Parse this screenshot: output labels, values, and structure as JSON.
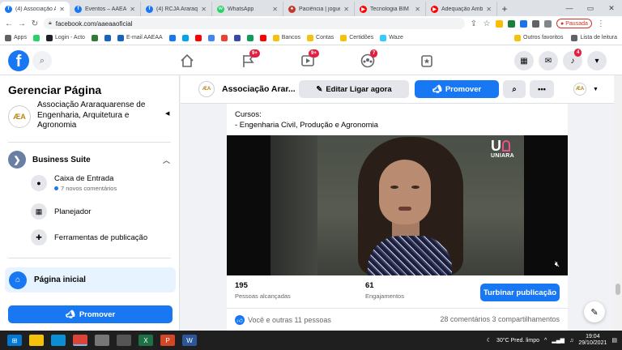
{
  "browser": {
    "tabs": [
      {
        "title": "(4) Associação Ar",
        "color": "#1877f2",
        "glyph": "f",
        "active": true
      },
      {
        "title": "Eventos – AAEAA",
        "color": "#1877f2",
        "glyph": "f"
      },
      {
        "title": "(4) RCJA Araraqu",
        "color": "#1877f2",
        "glyph": "f"
      },
      {
        "title": "WhatsApp",
        "color": "#25d366",
        "glyph": "w"
      },
      {
        "title": "Paciência | jogue",
        "color": "#c0392b",
        "glyph": "♠"
      },
      {
        "title": "Tecnologia BIM",
        "color": "#ff0000",
        "glyph": "▶"
      },
      {
        "title": "Adequação Amb",
        "color": "#ff0000",
        "glyph": "▶"
      }
    ],
    "new_tab": "+",
    "url": "facebook.com/aaeaaoficial",
    "paused_label": "Pausada",
    "bookmarks": [
      {
        "label": "Apps",
        "color": "#5f6368"
      },
      {
        "label": "",
        "color": "#25d366"
      },
      {
        "label": "Login - Acto",
        "color": "#202124"
      },
      {
        "label": "",
        "color": "#2e7d32"
      },
      {
        "label": "",
        "color": "#1565c0"
      },
      {
        "label": "E-mail AAEAA",
        "color": "#1565c0"
      },
      {
        "label": "",
        "color": "#1877f2"
      },
      {
        "label": "",
        "color": "#00a4ef"
      },
      {
        "label": "",
        "color": "#ff0000"
      },
      {
        "label": "",
        "color": "#4285f4"
      },
      {
        "label": "",
        "color": "#ea4335"
      },
      {
        "label": "",
        "color": "#3949ab"
      },
      {
        "label": "",
        "color": "#0f9d58"
      },
      {
        "label": "",
        "color": "#ff0000"
      },
      {
        "label": "Bancos",
        "color": "#f4c20d"
      },
      {
        "label": "Contas",
        "color": "#f4c20d"
      },
      {
        "label": "Certidões",
        "color": "#f4c20d"
      },
      {
        "label": "Waze",
        "color": "#33ccff"
      }
    ],
    "bookmarks_right": [
      "Outros favoritos",
      "Lista de leitura"
    ]
  },
  "fb_nav": {
    "logo": "f",
    "badges": {
      "pages": "9+",
      "watch": "9+",
      "groups": "7",
      "notifications": "4"
    }
  },
  "sidebar": {
    "title": "Gerenciar Página",
    "page_name": "Associação Araraquarense de Engenharia, Arquitetura e Agronomia",
    "avatar_text": "ÆA",
    "suite_label": "Business Suite",
    "items": [
      {
        "label": "Caixa de Entrada",
        "sub": "7 novos comentários"
      },
      {
        "label": "Planejador",
        "sub": ""
      },
      {
        "label": "Ferramentas de publicação",
        "sub": ""
      }
    ],
    "home_label": "Página inicial",
    "promote_label": "Promover"
  },
  "page_header": {
    "name": "Associação Arar...",
    "edit_label": "Editar Ligar agora",
    "promote_label": "Promover"
  },
  "post": {
    "cut_text": "...",
    "courses_heading": "Cursos:",
    "courses_line": "- Engenharia Civil, Produção e Agronomia",
    "video_logo": "UNIARA",
    "reach_value": "195",
    "reach_label": "Pessoas alcançadas",
    "engagement_value": "61",
    "engagement_label": "Engajamentos",
    "boost_label": "Turbinar publicação",
    "reactions_text": "Você e outras 11 pessoas",
    "comments_shares": "28 comentários  3 compartilhamentos"
  },
  "taskbar": {
    "weather": "30°C  Pred. limpo",
    "time": "19:04",
    "date": "29/10/2021"
  }
}
